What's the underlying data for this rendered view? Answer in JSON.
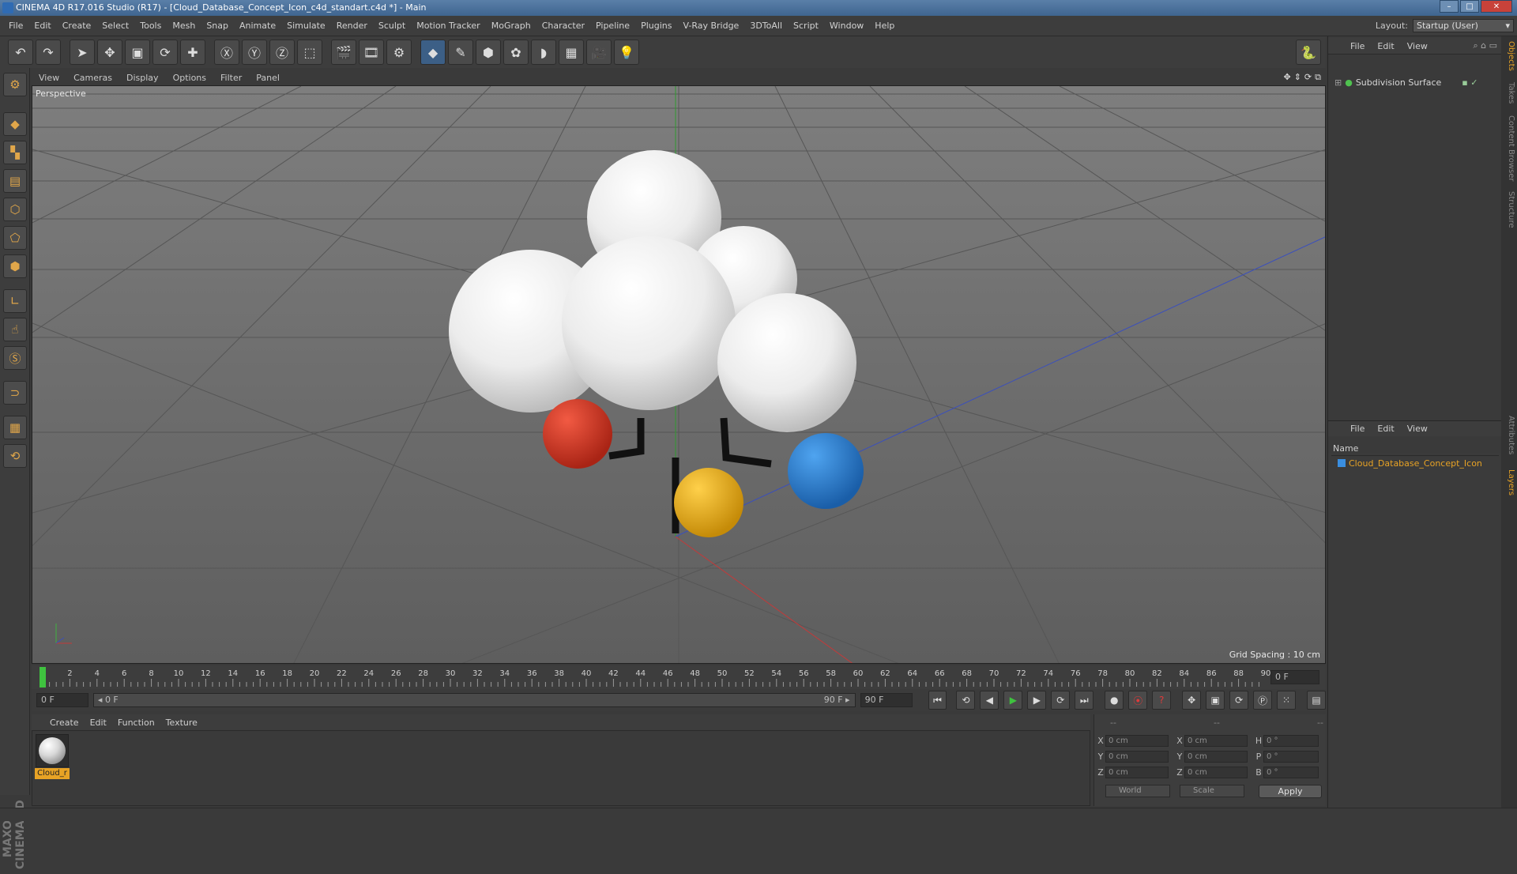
{
  "window": {
    "title": "CINEMA 4D R17.016 Studio (R17) - [Cloud_Database_Concept_Icon_c4d_standart.c4d *] - Main",
    "buttons": {
      "minimize": "–",
      "maximize": "□",
      "close": "✕"
    }
  },
  "menu": {
    "items": [
      "File",
      "Edit",
      "Create",
      "Select",
      "Tools",
      "Mesh",
      "Snap",
      "Animate",
      "Simulate",
      "Render",
      "Sculpt",
      "Motion Tracker",
      "MoGraph",
      "Character",
      "Pipeline",
      "Plugins",
      "V-Ray Bridge",
      "3DToAll",
      "Script",
      "Window",
      "Help"
    ],
    "layout_label": "Layout:",
    "layout_value": "Startup (User)"
  },
  "viewport": {
    "menu": [
      "View",
      "Cameras",
      "Display",
      "Options",
      "Filter",
      "Panel"
    ],
    "label": "Perspective",
    "grid_spacing": "Grid Spacing : 10 cm"
  },
  "timeline": {
    "ticks": [
      "0",
      "2",
      "4",
      "6",
      "8",
      "10",
      "12",
      "14",
      "16",
      "18",
      "20",
      "22",
      "24",
      "26",
      "28",
      "30",
      "32",
      "34",
      "36",
      "38",
      "40",
      "42",
      "44",
      "46",
      "48",
      "50",
      "52",
      "54",
      "56",
      "58",
      "60",
      "62",
      "64",
      "66",
      "68",
      "70",
      "72",
      "74",
      "76",
      "78",
      "80",
      "82",
      "84",
      "86",
      "88",
      "90"
    ],
    "current_frame": "0 F",
    "start_field": "0 F",
    "range_start": "◂ 0 F",
    "range_end": "90 F ▸",
    "end_field": "90 F"
  },
  "material_manager": {
    "menu": [
      "Create",
      "Edit",
      "Function",
      "Texture"
    ],
    "material_name": "Cloud_r"
  },
  "coordinates": {
    "header_dashes": [
      "--",
      "--",
      "--"
    ],
    "rows": [
      {
        "axis": "X",
        "pos": "0 cm",
        "axis2": "X",
        "size": "0 cm",
        "axis3": "H",
        "rot": "0 °"
      },
      {
        "axis": "Y",
        "pos": "0 cm",
        "axis2": "Y",
        "size": "0 cm",
        "axis3": "P",
        "rot": "0 °"
      },
      {
        "axis": "Z",
        "pos": "0 cm",
        "axis2": "Z",
        "size": "0 cm",
        "axis3": "B",
        "rot": "0 °"
      }
    ],
    "mode_world": "World",
    "mode_scale": "Scale",
    "apply": "Apply"
  },
  "objects_panel": {
    "menu": [
      "File",
      "Edit",
      "View"
    ],
    "object_name": "Subdivision Surface"
  },
  "layers_panel": {
    "menu": [
      "File",
      "Edit",
      "View"
    ],
    "header_name": "Name",
    "layer_name": "Cloud_Database_Concept_Icon"
  },
  "side_tabs": [
    "Objects",
    "Takes",
    "Content Browser",
    "Structure",
    "Attributes",
    "Layers"
  ],
  "brand": "MAXON CINEMA 4D",
  "colors": {
    "accent": "#e8a325",
    "sphere_red": "#d93a2a",
    "sphere_yellow": "#f0b623",
    "sphere_blue": "#2f8be0"
  }
}
